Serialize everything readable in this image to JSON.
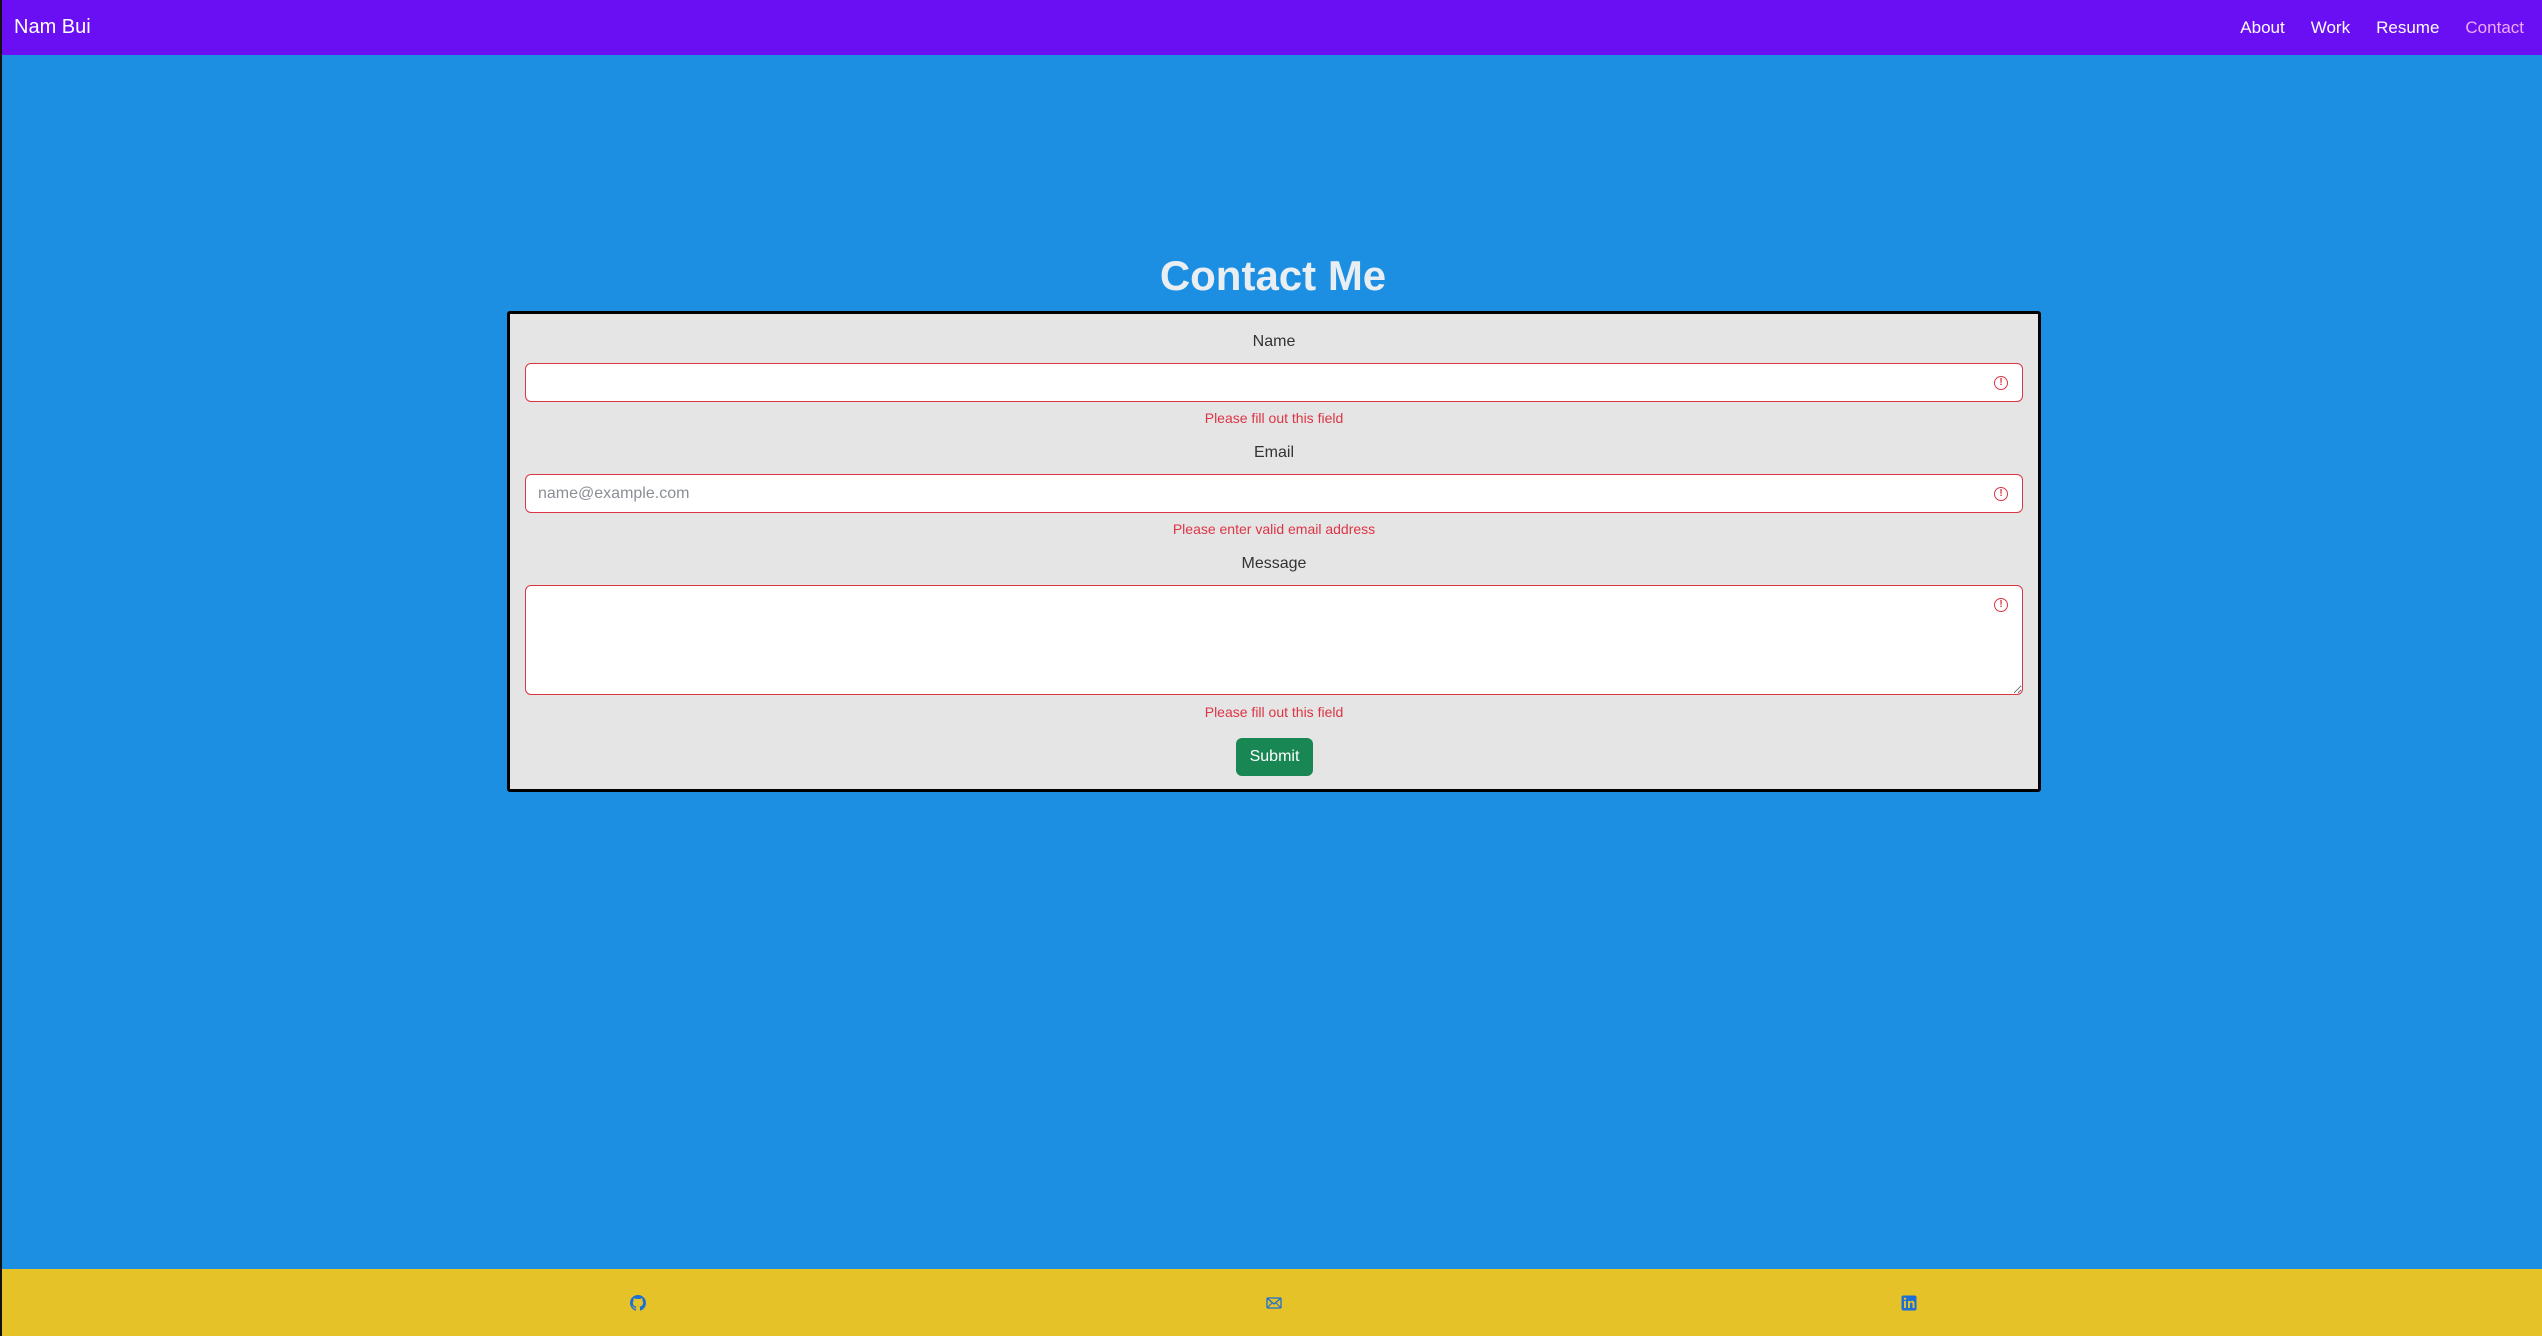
{
  "navbar": {
    "brand": "Nam Bui",
    "links": [
      "About",
      "Work",
      "Resume",
      "Contact"
    ],
    "active": "Contact"
  },
  "page_title": "Contact Me",
  "form": {
    "name_label": "Name",
    "name_value": "",
    "name_error": "Please fill out this field",
    "email_label": "Email",
    "email_placeholder": "name@example.com",
    "email_value": "",
    "email_error": "Please enter valid email address",
    "message_label": "Message",
    "message_value": "",
    "message_error": "Please fill out this field",
    "submit_label": "Submit"
  },
  "footer": {
    "icons": [
      "github-icon",
      "mail-icon",
      "linkedin-icon"
    ]
  },
  "colors": {
    "navbar": "#6a0ff3",
    "background": "#1c8fe3",
    "card": "#e5e5e5",
    "error": "#dc3545",
    "submit": "#198754",
    "footer": "#e5c227",
    "active_link": "#f3a9f6"
  }
}
